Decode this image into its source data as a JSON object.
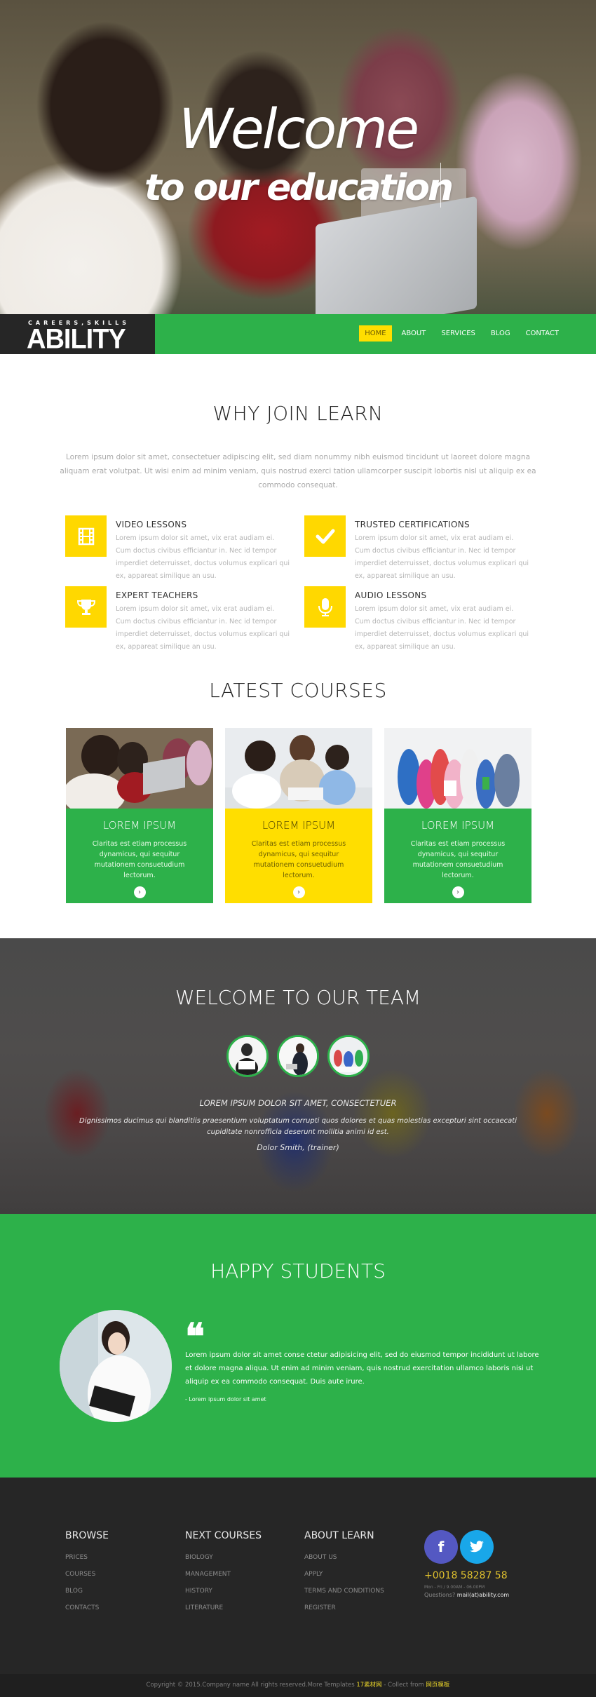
{
  "hero": {
    "title": "Welcome",
    "subtitle": "to our education"
  },
  "nav": {
    "logo_tagline": "CAREERS,SKILLS",
    "logo_name": "ABILITY",
    "links": [
      {
        "label": "HOME",
        "active": true
      },
      {
        "label": "ABOUT",
        "active": false
      },
      {
        "label": "SERVICES",
        "active": false
      },
      {
        "label": "BLOG",
        "active": false
      },
      {
        "label": "CONTACT",
        "active": false
      }
    ]
  },
  "why": {
    "title": "WHY JOIN LEARN",
    "intro": "Lorem ipsum dolor sit amet, consectetuer adipiscing elit, sed diam nonummy nibh euismod tincidunt ut laoreet dolore magna aliquam erat volutpat. Ut wisi enim ad minim veniam, quis nostrud exerci tation ullamcorper suscipit lobortis nisl ut aliquip ex ea commodo consequat.",
    "features": [
      {
        "icon": "film-icon",
        "title": "VIDEO LESSONS",
        "text": "Lorem ipsum dolor sit amet, vix erat audiam ei. Cum doctus civibus efficiantur in. Nec id tempor imperdiet deterruisset, doctus volumus explicari qui ex, appareat similique an usu."
      },
      {
        "icon": "check-icon",
        "title": "TRUSTED CERTIFICATIONS",
        "text": "Lorem ipsum dolor sit amet, vix erat audiam ei. Cum doctus civibus efficiantur in. Nec id tempor imperdiet deterruisset, doctus volumus explicari qui ex, appareat similique an usu."
      },
      {
        "icon": "trophy-icon",
        "title": "EXPERT TEACHERS",
        "text": "Lorem ipsum dolor sit amet, vix erat audiam ei. Cum doctus civibus efficiantur in. Nec id tempor imperdiet deterruisset, doctus volumus explicari qui ex, appareat similique an usu."
      },
      {
        "icon": "microphone-icon",
        "title": "AUDIO LESSONS",
        "text": "Lorem ipsum dolor sit amet, vix erat audiam ei. Cum doctus civibus efficiantur in. Nec id tempor imperdiet deterruisset, doctus volumus explicari qui ex, appareat similique an usu."
      }
    ]
  },
  "courses": {
    "title": "LATEST COURSES",
    "items": [
      {
        "title": "LOREM IPSUM",
        "text": "Claritas est etiam processus dynamicus, qui sequitur mutationem consuetudium lectorum.",
        "color": "#2db14a",
        "arrow": "›"
      },
      {
        "title": "LOREM IPSUM",
        "text": "Claritas est etiam processus dynamicus, qui sequitur mutationem consuetudium lectorum.",
        "color": "#ffde00",
        "arrow": "›"
      },
      {
        "title": "LOREM IPSUM",
        "text": "Claritas est etiam processus dynamicus, qui sequitur mutationem consuetudium lectorum.",
        "color": "#2db14a",
        "arrow": "›"
      }
    ]
  },
  "team": {
    "title": "WELCOME TO OUR TEAM",
    "quote_title": "LOREM IPSUM DOLOR SIT AMET, CONSECTETUER",
    "quote": "Dignissimos ducimus qui blanditiis praesentium voluptatum corrupti quos dolores et quas molestias excepturi sint occaecati cupiditate nonrofficia deserunt mollitia animi id est.",
    "author": "Dolor Smith, (trainer)"
  },
  "happy": {
    "title": "HAPPY STUDENTS",
    "quote_mark": "❝",
    "text": "Lorem ipsum dolor sit amet conse ctetur adipisicing elit, sed do eiusmod tempor incididunt ut labore et dolore magna aliqua. Ut enim ad minim veniam, quis nostrud exercitation ullamco laboris nisi ut aliquip ex ea commodo consequat. Duis aute irure.",
    "author": "-   Lorem ipsum dolor sit amet"
  },
  "footer": {
    "columns": [
      {
        "title": "BROWSE",
        "links": [
          "PRICES",
          "COURSES",
          "BLOG",
          "CONTACTS"
        ]
      },
      {
        "title": "NEXT COURSES",
        "links": [
          "BIOLOGY",
          "MANAGEMENT",
          "HISTORY",
          "LITERATURE"
        ]
      },
      {
        "title": "ABOUT LEARN",
        "links": [
          "ABOUT US",
          "APPLY",
          "TERMS AND CONDITIONS",
          "REGISTER"
        ]
      }
    ],
    "social": {
      "facebook": "f",
      "twitter": "🐦"
    },
    "phone": "+0018 58287 58",
    "hours": "Mon - Fri / 9.00AM - 06.00PM",
    "questions_label": "Questions?",
    "email": "mail(at)ability.com"
  },
  "copyright": {
    "text": "Copyright © 2015.Company name All rights reserved.More Templates ",
    "link1": "17素材网",
    "middle": " - Collect from ",
    "link2": "网页模板"
  },
  "colors": {
    "green": "#2db14a",
    "yellow": "#ffde00",
    "dark": "#262626",
    "facebook": "#5458c2",
    "twitter": "#19a7e9",
    "phone": "#e0c12d"
  }
}
